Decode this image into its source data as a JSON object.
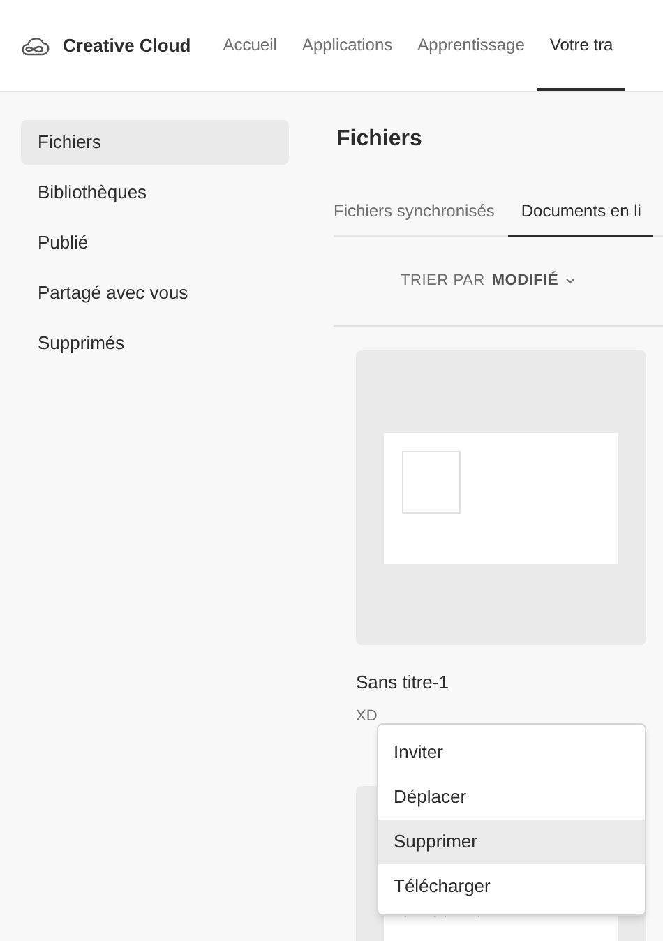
{
  "header": {
    "brand": "Creative Cloud",
    "nav": [
      {
        "label": "Accueil",
        "selected": false
      },
      {
        "label": "Applications",
        "selected": false
      },
      {
        "label": "Apprentissage",
        "selected": false
      },
      {
        "label": "Votre tra",
        "selected": true
      }
    ]
  },
  "sidebar": {
    "items": [
      {
        "label": "Fichiers",
        "selected": true
      },
      {
        "label": "Bibliothèques",
        "selected": false
      },
      {
        "label": "Publié",
        "selected": false
      },
      {
        "label": "Partagé avec vous",
        "selected": false
      },
      {
        "label": "Supprimés",
        "selected": false
      }
    ]
  },
  "main": {
    "title": "Fichiers",
    "tabs": [
      {
        "label": "Fichiers synchronisés",
        "selected": false
      },
      {
        "label": "Documents en li",
        "selected": true
      }
    ],
    "sort": {
      "label": "TRIER PAR",
      "value": "MODIFIÉ"
    },
    "files": [
      {
        "name": "Sans titre-1",
        "type": "XD"
      }
    ],
    "context_menu": [
      {
        "label": "Inviter",
        "selected": false
      },
      {
        "label": "Déplacer",
        "selected": false
      },
      {
        "label": "Supprimer",
        "selected": true
      },
      {
        "label": "Télécharger",
        "selected": false
      }
    ]
  }
}
